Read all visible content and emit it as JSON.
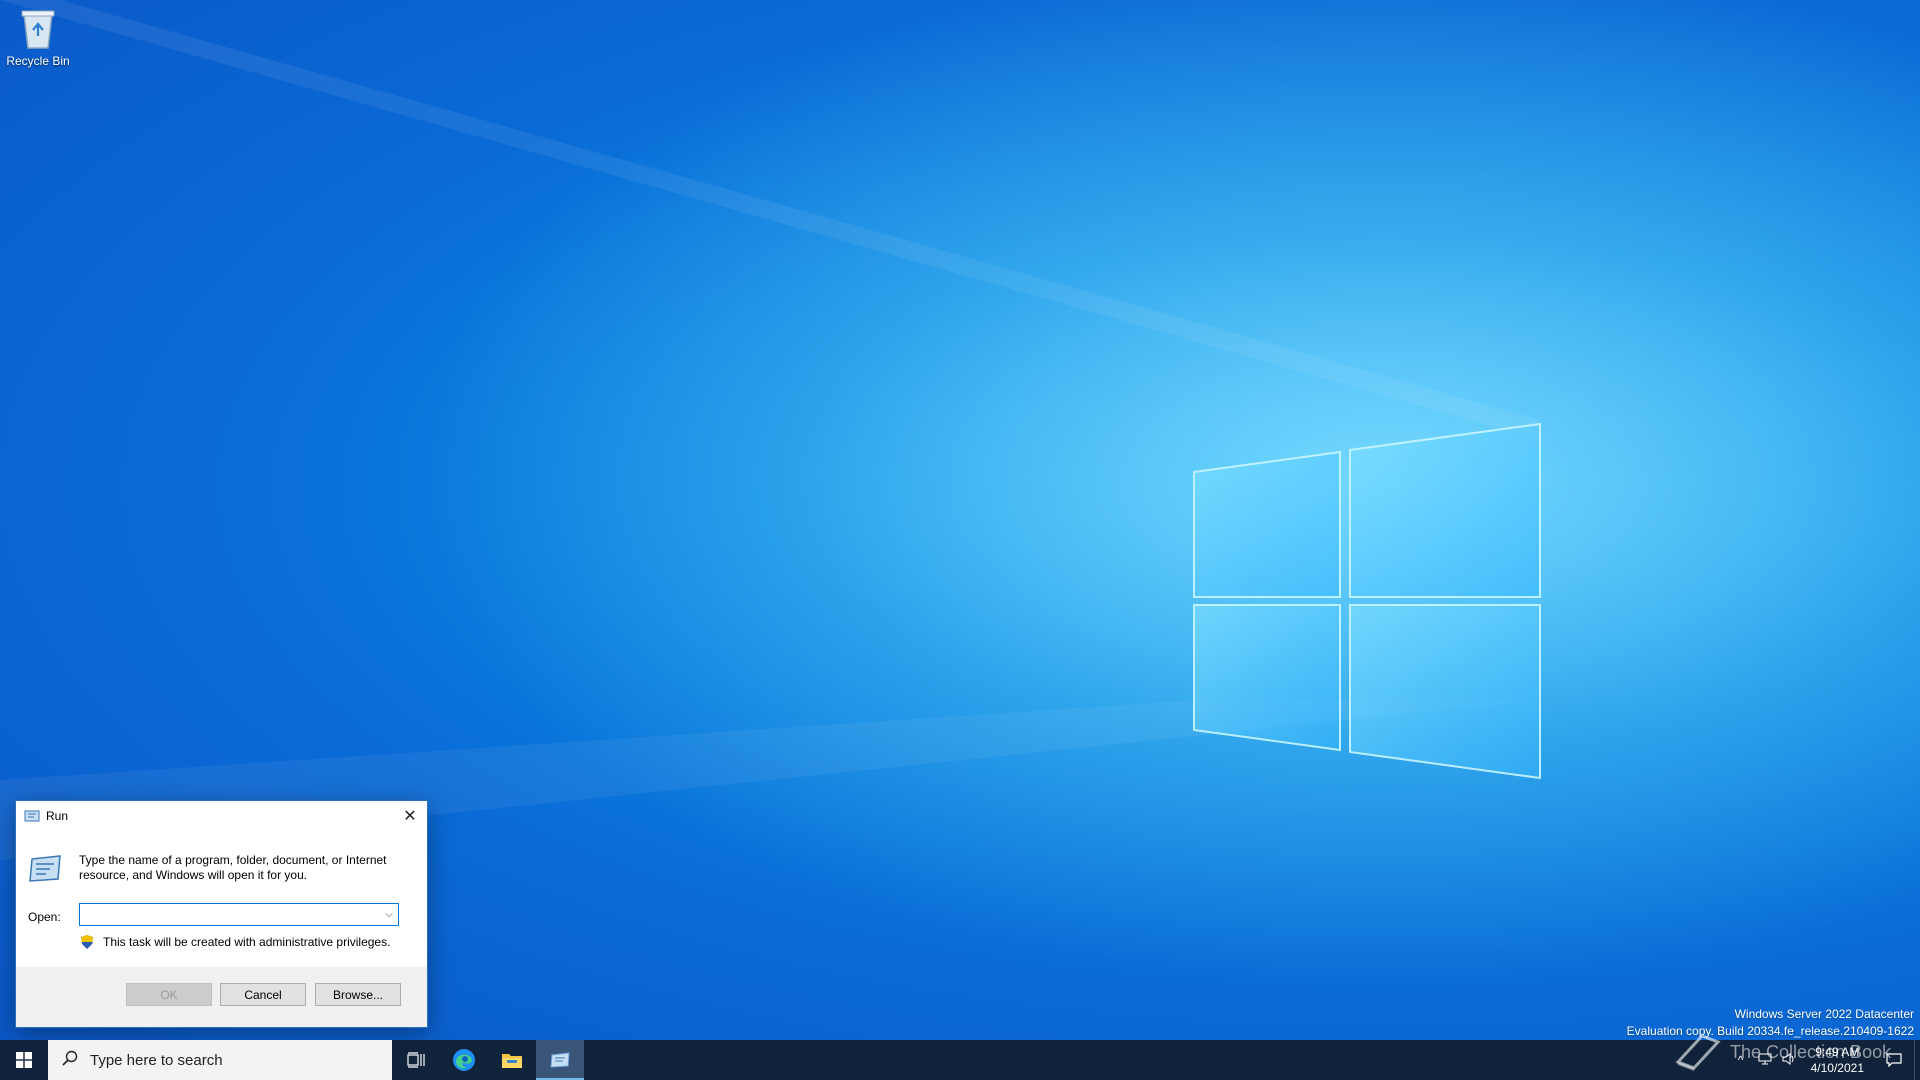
{
  "desktop": {
    "icons": [
      {
        "label": "Recycle Bin",
        "icon": "recycle-bin-icon"
      }
    ]
  },
  "run_dialog": {
    "title": "Run",
    "description": "Type the name of a program, folder, document, or Internet resource, and Windows will open it for you.",
    "open_label": "Open:",
    "open_value": "",
    "admin_note": "This task will be created with administrative privileges.",
    "buttons": {
      "ok": "OK",
      "cancel": "Cancel",
      "browse": "Browse..."
    }
  },
  "watermark": {
    "line1": "Windows Server 2022 Datacenter",
    "line2": "Evaluation copy. Build 20334.fe_release.210409-1622"
  },
  "taskbar": {
    "search_placeholder": "Type here to search",
    "pinned": [
      "task-view-icon",
      "edge-icon",
      "file-explorer-icon",
      "run-icon"
    ],
    "brand_overlay": "The Collection Book",
    "clock": {
      "time": "9:49 AM",
      "date": "4/10/2021"
    }
  },
  "colors": {
    "accent": "#0078d7",
    "taskbar": "#10233a",
    "wallpaper": "#0a8fe6"
  }
}
